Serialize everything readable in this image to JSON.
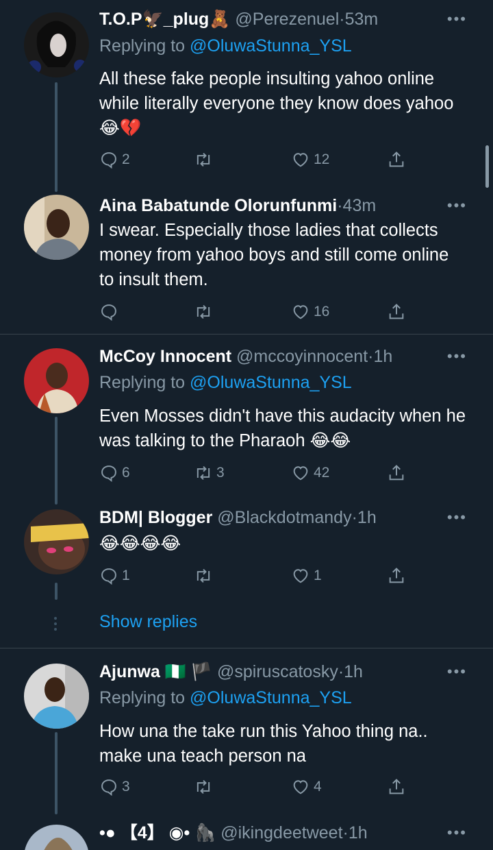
{
  "scrollbar": true,
  "tweets": [
    {
      "name": "T.O.P🦅_plug🧸",
      "handle": "@Perezenuel",
      "time": "53m",
      "reply_prefix": "Replying to",
      "reply_to": "@OluwaStunna_YSL",
      "text": "All these fake people insulting yahoo online while literally everyone they know does yahoo",
      "emojis": [
        "😂",
        "💔"
      ],
      "replies": "2",
      "retweets": "",
      "likes": "12"
    },
    {
      "name": "Aina Babatunde Olorunfunmi",
      "handle": "",
      "time": "43m",
      "text": "I swear. Especially those ladies that collects money from yahoo boys and still come online to insult them.",
      "replies": "",
      "retweets": "",
      "likes": "16"
    },
    {
      "name": "McCoy Innocent",
      "handle": "@mccoyinnocent",
      "time": "1h",
      "reply_prefix": "Replying to",
      "reply_to": "@OluwaStunna_YSL",
      "text": "Even Mosses didn't have this audacity when he was talking to the Pharaoh",
      "emojis": [
        "😂",
        "😂"
      ],
      "replies": "6",
      "retweets": "3",
      "likes": "42"
    },
    {
      "name": "BDM| Blogger",
      "handle": "@Blackdotmandy",
      "time": "1h",
      "emojis": [
        "😂",
        "😂",
        "😂",
        "😂"
      ],
      "replies": "1",
      "retweets": "",
      "likes": "1"
    },
    {
      "name": "Ajunwa 🇳🇬 🏴",
      "handle": "@spiruscatosky",
      "time": "1h",
      "reply_prefix": "Replying to",
      "reply_to": "@OluwaStunna_YSL",
      "text": "How una the take run this Yahoo thing na.. make una teach person na",
      "replies": "3",
      "retweets": "",
      "likes": "4"
    },
    {
      "name": "•● 【4】 ◉• 🦍",
      "handle": "@ikingdeetweet",
      "time": "1h"
    }
  ],
  "show_replies": "Show replies",
  "separator": "·",
  "more_label": "•••",
  "colors": {
    "background": "#15202b",
    "accent": "#1da1f2",
    "muted": "#8899a6",
    "divider": "#38444d"
  }
}
